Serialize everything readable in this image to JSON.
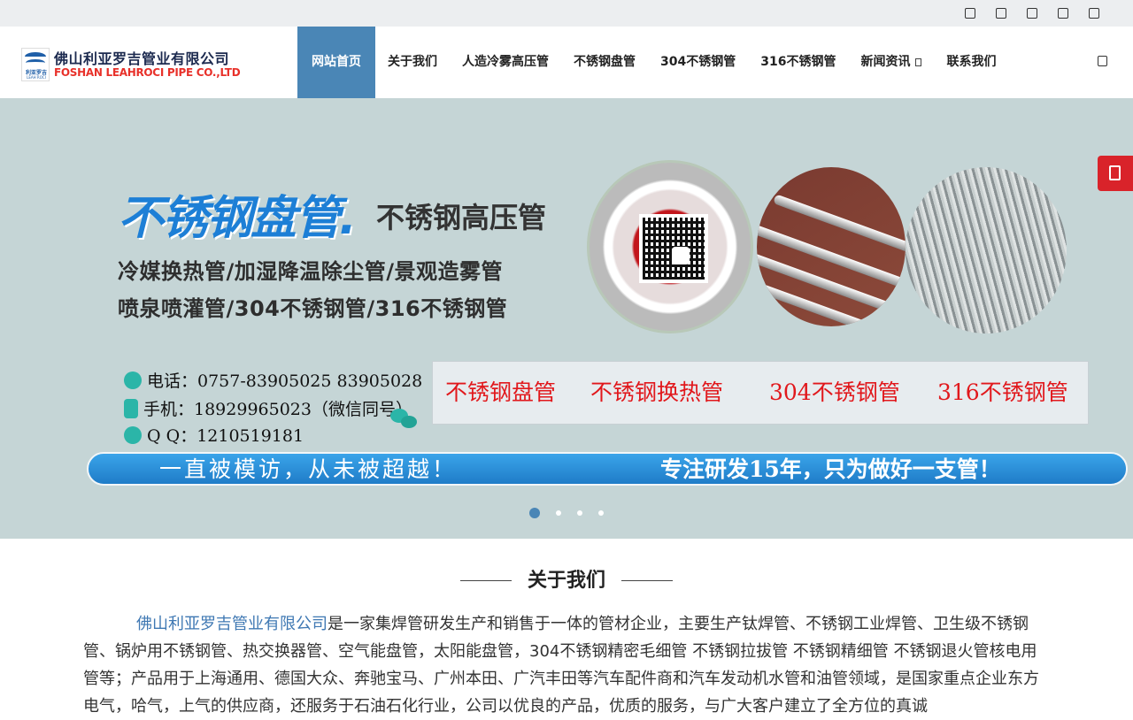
{
  "colors": {
    "accent": "#4a86b6",
    "red": "#e1181c",
    "banner_bg": "#c5d5d6"
  },
  "topbar": {
    "icons": [
      "square-icon",
      "square-icon",
      "square-icon",
      "square-icon",
      "square-icon"
    ]
  },
  "logo": {
    "mark_cn": "利亚罗吉",
    "mark_en": "LEAH ROCI",
    "cn": "佛山利亚罗吉管业有限公司",
    "en": "FOSHAN LEAHROCI PIPE CO.,LTD"
  },
  "nav": {
    "items": [
      "网站首页",
      "关于我们",
      "人造冷雾高压管",
      "不锈钢盘管",
      "304不锈钢管",
      "316不锈钢管",
      "新闻资讯",
      "联系我们"
    ],
    "active_index": 0
  },
  "banner": {
    "title_main": "不锈钢盘管.",
    "title_sub": "不锈钢高压管",
    "line1": "冷媒换热管/加湿降温除尘管/景观造雾管",
    "line2": "喷泉喷灌管/304不锈钢管/316不锈钢管",
    "phone": "电话：0757-83905025  83905028",
    "mobile": "手机：18929965023（微信同号）",
    "qq": "Q Q：1210519181",
    "red_items": [
      "不锈钢盘管",
      "不锈钢换热管",
      "304不锈钢管",
      "316不锈钢管"
    ],
    "slogan_left": "一直被模访，从未被超越！",
    "slogan_right": "专注研发15年，只为做好一支管！",
    "slide_count": 4,
    "active_slide": 1
  },
  "about": {
    "title": "关于我们",
    "company": "佛山利亚罗吉管业有限公司",
    "text": "是一家集焊管研发生产和销售于一体的管材企业，主要生产钛焊管、不锈钢工业焊管、卫生级不锈钢管、锅炉用不锈钢管、热交换器管、空气能盘管，太阳能盘管，304不锈钢精密毛细管 不锈钢拉拔管 不锈钢精细管 不锈钢退火管核电用管等；产品用于上海通用、德国大众、奔驰宝马、广州本田、广汽丰田等汽车配件商和汽车发动机水管和油管领域，是国家重点企业东方电气，哈气，上气的供应商，还服务于石油石化行业，公司以优良的产品，优质的服务，与广大客户建立了全方位的真诚"
  }
}
